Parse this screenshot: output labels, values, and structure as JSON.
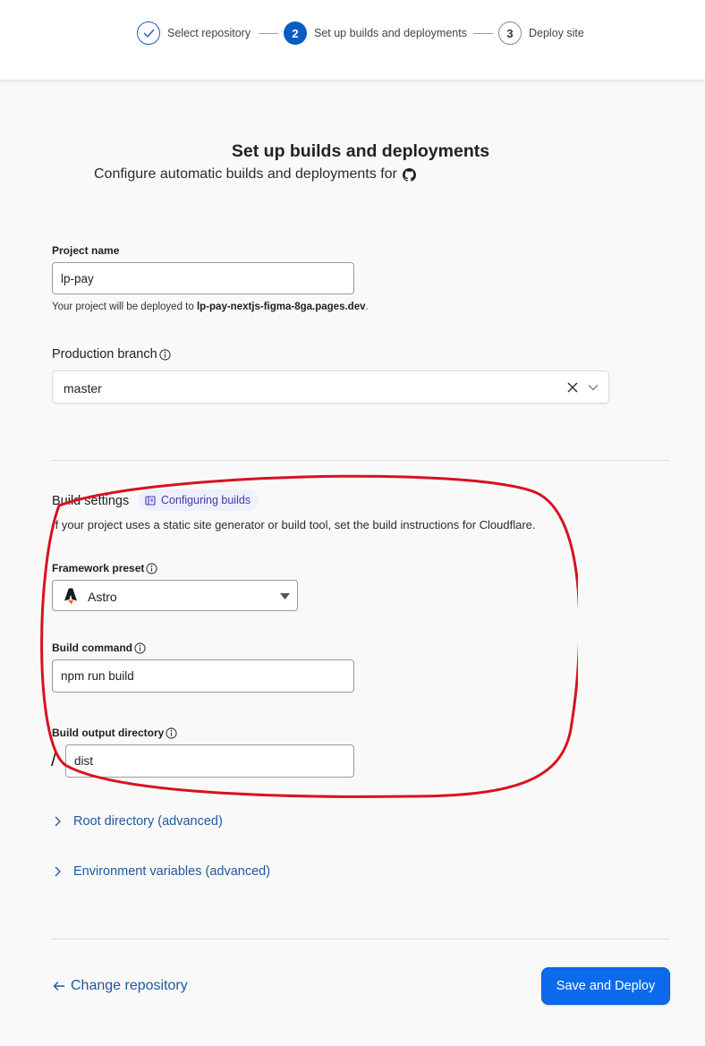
{
  "stepper": {
    "steps": [
      {
        "number": "",
        "label": "Select repository",
        "state": "done"
      },
      {
        "number": "2",
        "label": "Set up builds and deployments",
        "state": "active"
      },
      {
        "number": "3",
        "label": "Deploy site",
        "state": "pending"
      }
    ]
  },
  "header": {
    "title": "Set up builds and deployments",
    "subtitle": "Configure automatic builds and deployments for"
  },
  "project": {
    "label": "Project name",
    "value": "lp-pay",
    "help_prefix": "Your project will be deployed to ",
    "help_domain": "lp-pay-nextjs-figma-8ga.pages.dev",
    "help_suffix": "."
  },
  "branch": {
    "label": "Production branch",
    "value": "master"
  },
  "build_settings": {
    "title": "Build settings",
    "doc_link": "Configuring builds",
    "description": "If your project uses a static site generator or build tool, set the build instructions for Cloudflare.",
    "framework_label": "Framework preset",
    "framework_value": "Astro",
    "command_label": "Build command",
    "command_value": "npm run build",
    "output_label": "Build output directory",
    "output_prefix": "/",
    "output_value": "dist"
  },
  "advanced": {
    "root": "Root directory (advanced)",
    "env": "Environment variables (advanced)"
  },
  "footer": {
    "change_repo": "Change repository",
    "deploy_button": "Save and Deploy"
  },
  "colors": {
    "accent": "#0b6bec",
    "link": "#1e5aa0",
    "annotation": "#d8121f"
  }
}
